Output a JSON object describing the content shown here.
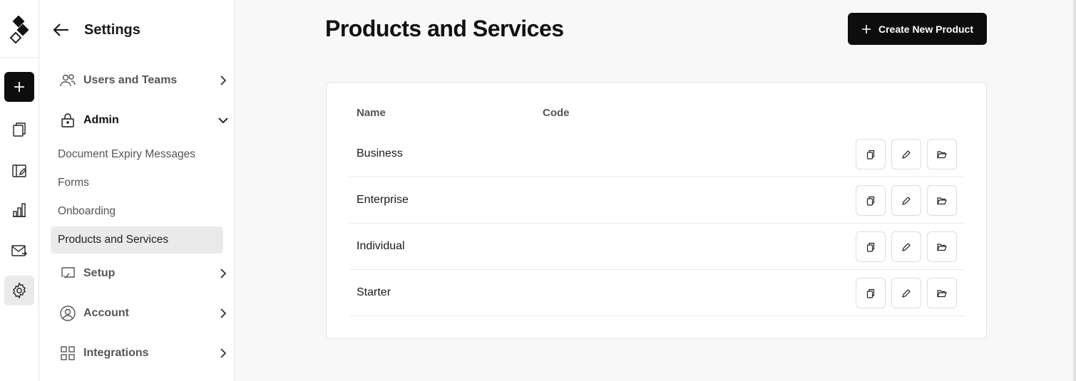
{
  "sidebar": {
    "title": "Settings",
    "items": {
      "users": {
        "label": "Users and Teams",
        "icon": "users-icon"
      },
      "admin": {
        "label": "Admin",
        "icon": "lock-icon",
        "expanded": true
      },
      "setup": {
        "label": "Setup",
        "icon": "checklist-icon"
      },
      "account": {
        "label": "Account",
        "icon": "user-circle-icon"
      },
      "integrations": {
        "label": "Integrations",
        "icon": "grid-icon"
      }
    },
    "admin_subitems": [
      {
        "label": "Document Expiry Messages"
      },
      {
        "label": "Forms"
      },
      {
        "label": "Onboarding"
      },
      {
        "label": "Products and Services",
        "active": true
      }
    ]
  },
  "rail": {
    "icons": [
      "logo-icon",
      "plus-icon",
      "documents-icon",
      "templates-icon",
      "reports-icon",
      "mail-icon",
      "gear-icon"
    ]
  },
  "main": {
    "title": "Products and Services",
    "create_button": "Create New Product",
    "table": {
      "columns": [
        "Name",
        "Code"
      ],
      "rows": [
        {
          "name": "Business",
          "code": ""
        },
        {
          "name": "Enterprise",
          "code": ""
        },
        {
          "name": "Individual",
          "code": ""
        },
        {
          "name": "Starter",
          "code": ""
        }
      ],
      "row_actions": [
        "copy-icon",
        "edit-icon",
        "folder-icon"
      ]
    }
  },
  "colors": {
    "primary": "#0d0d0d",
    "background": "#f8f8f8",
    "active_item": "#eaeaea"
  }
}
